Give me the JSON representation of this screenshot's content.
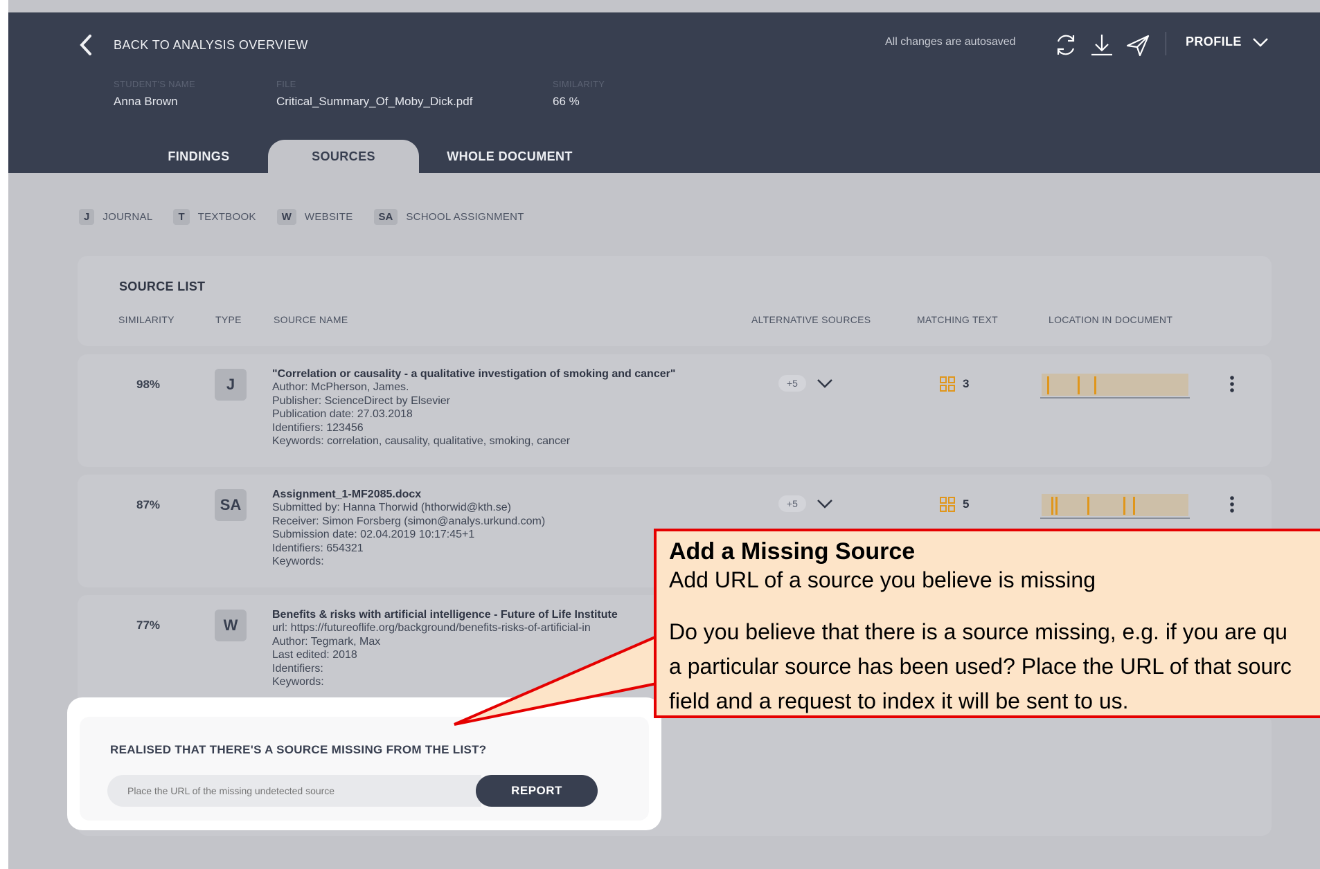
{
  "header": {
    "back_label": "BACK TO ANALYSIS OVERVIEW",
    "autosave": "All changes are autosaved",
    "profile_label": "PROFILE",
    "student_label": "STUDENT'S NAME",
    "student_value": "Anna Brown",
    "file_label": "FILE",
    "file_value": "Critical_Summary_Of_Moby_Dick.pdf",
    "similarity_label": "SIMILARITY",
    "similarity_value": "66 %"
  },
  "tabs": [
    {
      "label": "FINDINGS",
      "active": false
    },
    {
      "label": "SOURCES",
      "active": true
    },
    {
      "label": "WHOLE DOCUMENT",
      "active": false
    }
  ],
  "legend": [
    {
      "code": "J",
      "label": "JOURNAL"
    },
    {
      "code": "T",
      "label": "TEXTBOOK"
    },
    {
      "code": "W",
      "label": "WEBSITE"
    },
    {
      "code": "SA",
      "label": "SCHOOL ASSIGNMENT"
    }
  ],
  "source_list": {
    "title": "SOURCE LIST",
    "columns": [
      "SIMILARITY",
      "TYPE",
      "SOURCE NAME",
      "ALTERNATIVE SOURCES",
      "MATCHING TEXT",
      "LOCATION IN DOCUMENT"
    ],
    "rows": [
      {
        "similarity": "98%",
        "type": "J",
        "name": "\"Correlation or causality - a qualitative investigation of smoking and cancer\"",
        "lines": [
          "Author: McPherson, James.",
          "Publisher: ScienceDirect by Elsevier",
          "Publication date: 27.03.2018",
          "Identifiers: 123456",
          "Keywords: correlation, causality, qualitative, smoking, cancer"
        ],
        "alt": "+5",
        "matching": "3"
      },
      {
        "similarity": "87%",
        "type": "SA",
        "name": "Assignment_1-MF2085.docx",
        "lines": [
          "Submitted by: Hanna Thorwid (hthorwid@kth.se)",
          "Receiver: Simon Forsberg (simon@analys.urkund.com)",
          "Submission date: 02.04.2019 10:17:45+1",
          "Identifiers: 654321",
          "Keywords:"
        ],
        "alt": "+5",
        "matching": "5"
      },
      {
        "similarity": "77%",
        "type": "W",
        "name": "Benefits & risks with artificial intelligence - Future of Life Institute",
        "lines": [
          "url: https://futureoflife.org/background/benefits-risks-of-artificial-in",
          "Author: Tegmark, Max",
          "Last edited: 2018",
          "Identifiers:",
          "Keywords:"
        ]
      }
    ]
  },
  "report": {
    "title": "REALISED THAT THERE'S A SOURCE MISSING FROM THE LIST?",
    "placeholder": "Place the URL of the missing undetected source",
    "button": "REPORT"
  },
  "callout": {
    "title": "Add  a Missing Source",
    "subtitle": "Add URL of a source you believe is missing",
    "body_line1": "Do you believe that there is a source missing, e.g. if you are qu",
    "body_line2": "a particular source has been used? Place the URL of that sourc",
    "body_line3": "field and a request to index it will be sent to us."
  },
  "colors": {
    "header_bg": "#383f50",
    "page_bg": "#c3c4c9",
    "accent_orange": "#e0961b",
    "callout_bg": "#fde4c8",
    "callout_border": "#e50000"
  },
  "icons": [
    "chevron-left-icon",
    "refresh-icon",
    "download-icon",
    "send-icon",
    "chevron-down-icon",
    "grid-icon",
    "kebab-menu-icon"
  ]
}
